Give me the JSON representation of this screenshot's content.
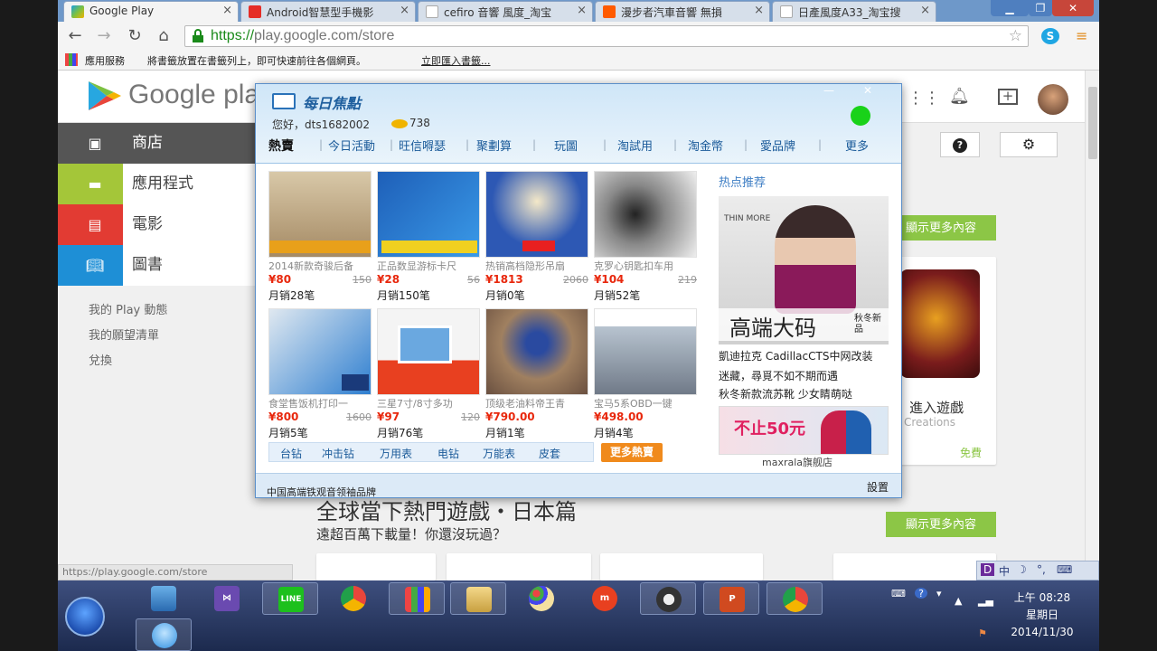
{
  "tabs": [
    {
      "label": "Google Play",
      "icon": "google-play-icon",
      "color": "#1aa0e0"
    },
    {
      "label": "Android智慧型手機影",
      "icon": "youtube-icon",
      "color": "#e52d27"
    },
    {
      "label": "cefiro 音響 風度_淘宝",
      "icon": "page-icon",
      "color": "#dcdcdc"
    },
    {
      "label": "漫步者汽車音響 無損",
      "icon": "taobao-icon",
      "color": "#ff5a00"
    },
    {
      "label": "日產風度A33_淘宝搜",
      "icon": "page-icon",
      "color": "#dcdcdc"
    }
  ],
  "omnibox": {
    "scheme": "https://",
    "rest": "play.google.com/store"
  },
  "bookmarks": {
    "apps": "應用服務",
    "hint": "將書籤放置在書籤列上，即可快速前往各個網頁。",
    "import": "立即匯入書籤..."
  },
  "play": {
    "logo_text": "Google pla",
    "store_label": "商店",
    "categories": [
      {
        "label": "應用程式",
        "color": "#a4c639"
      },
      {
        "label": "電影",
        "color": "#e23b33"
      },
      {
        "label": "圖書",
        "color": "#1e8fd6"
      }
    ],
    "links": [
      "我的 Play 動態",
      "我的願望清單",
      "兌換"
    ],
    "show_more": "顯示更多內容",
    "game_title": "進入遊戲",
    "game_sub": "Creations",
    "free": "免費",
    "headline": "全球當下熱門遊戲・日本篇",
    "subline": "遠超百萬下載量！你還沒玩過？",
    "status_url": "https://play.google.com/store"
  },
  "popup": {
    "title": "每日焦點",
    "greeting": "您好，dts1682002",
    "coins": "738",
    "nav": [
      "熱賣",
      "今日活動",
      "旺信嘚瑟",
      "聚劃算",
      "玩圖",
      "淘試用",
      "淘金幣",
      "愛品牌",
      "更多"
    ],
    "products": [
      {
        "name": "2014新款奇骏后备",
        "price": "¥80",
        "old": "150",
        "sales": "月销28笔",
        "bg": "#c9b79a"
      },
      {
        "name": "正品数显游标卡尺",
        "price": "¥28",
        "old": "56",
        "sales": "月销150笔",
        "bg": "#2b73c8"
      },
      {
        "name": "热销高档隐形吊扇",
        "price": "¥1813",
        "old": "2060",
        "sales": "月销0笔",
        "bg": "#3a5fb8"
      },
      {
        "name": "克罗心钥匙扣车用",
        "price": "¥104",
        "old": "219",
        "sales": "月销52笔",
        "bg": "#6b6b6b"
      },
      {
        "name": "食堂售饭机打印一",
        "price": "¥800",
        "old": "1600",
        "sales": "月销5笔",
        "bg": "#2f7fd0"
      },
      {
        "name": "三星7寸/8寸多功",
        "price": "¥97",
        "old": "120",
        "sales": "月销76笔",
        "bg": "#e84020"
      },
      {
        "name": "顶级老油料帝王青",
        "price": "¥790.00",
        "old": "",
        "sales": "月销1笔",
        "bg": "#8a6a4a"
      },
      {
        "name": "宝马5系OBD一键",
        "price": "¥498.00",
        "old": "",
        "sales": "月销4笔",
        "bg": "#a8b4c0"
      }
    ],
    "cats": [
      "台钻",
      "冲击钻",
      "万用表",
      "电钻",
      "万能表",
      "皮套"
    ],
    "more_hot": "更多熱賣",
    "hot_label": "热点推荐",
    "ad_brand": "THIN MORE",
    "ad_banner": "高端大码",
    "ad_banner_small": "秋冬新品",
    "ad_lines": [
      "凱迪拉克 CadillacCTS中网改装",
      "迷藏，尋覓不如不期而遇",
      "秋冬新款流苏靴 少女睛萌哒"
    ],
    "small_ad_text": "不止50元",
    "small_ad_label": "maxrala旗舰店",
    "footer_left": "中国高端铁观音领袖品牌",
    "footer_right": "設置"
  },
  "taskbar": {
    "time": "上午 08:28",
    "weekday": "星期日",
    "date": "2014/11/30",
    "apps": [
      "network-icon",
      "visual-studio-icon",
      "line-icon",
      "chrome-icon",
      "apps-grid-icon",
      "file-explorer-icon",
      "paint-icon",
      "media-m-icon",
      "film-reel-icon",
      "powerpoint-icon",
      "chrome-icon-2"
    ],
    "line_label": "LINE",
    "ppt_label": "P"
  },
  "langbar": {
    "items": [
      "D",
      "中",
      "☽",
      "°,",
      "⌨"
    ]
  }
}
